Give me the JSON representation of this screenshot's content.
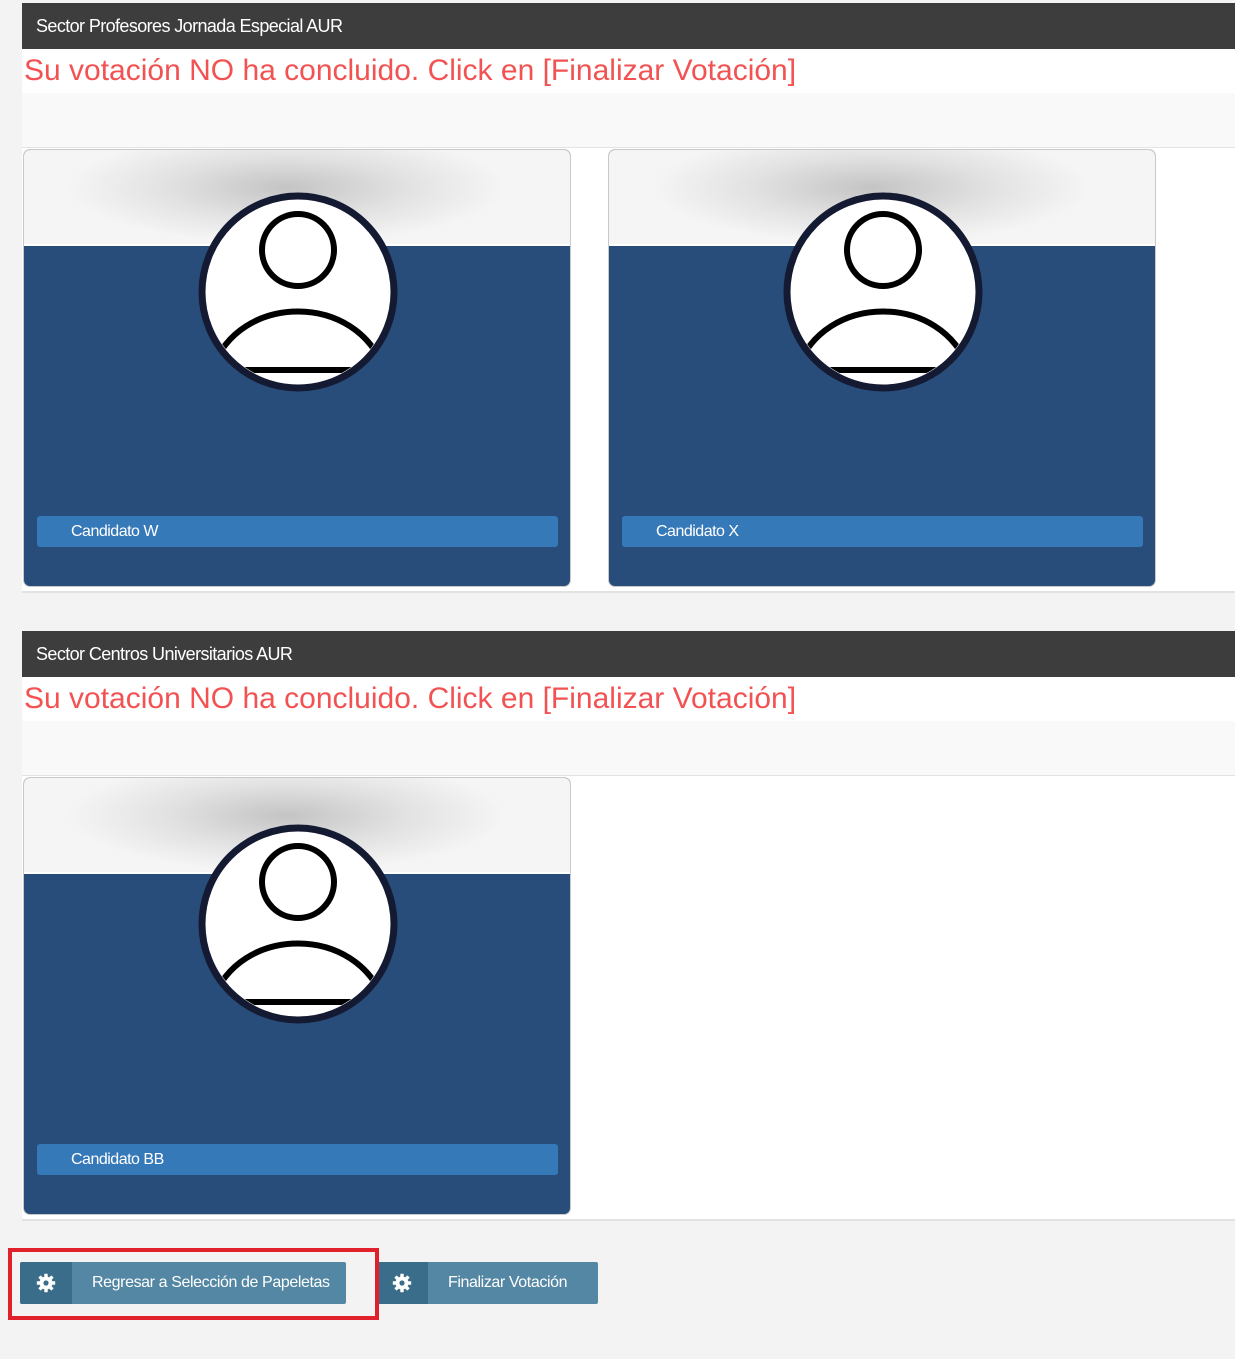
{
  "colors": {
    "header_bg": "#3d3d3d",
    "warning_text": "#f25252",
    "card_bg": "#284d7a",
    "label_bg": "#3679b9",
    "button_bg": "#5487a3",
    "highlight_border": "#e0202a"
  },
  "sections": [
    {
      "title": "Sector Profesores Jornada Especial AUR",
      "warning": "Su votación NO ha concluido. Click en [Finalizar Votación]",
      "candidates": [
        {
          "name": "Candidato W",
          "icon": "user-avatar-icon"
        },
        {
          "name": "Candidato X",
          "icon": "user-avatar-icon"
        }
      ]
    },
    {
      "title": "Sector Centros Universitarios AUR",
      "warning": "Su votación NO ha concluido. Click en [Finalizar Votación]",
      "candidates": [
        {
          "name": "Candidato BB",
          "icon": "user-avatar-icon"
        }
      ]
    }
  ],
  "actions": {
    "back_label": "Regresar a Selección de Papeletas",
    "back_icon": "gear-icon",
    "finish_label": "Finalizar Votación",
    "finish_icon": "gear-icon",
    "highlighted": "back_button"
  }
}
